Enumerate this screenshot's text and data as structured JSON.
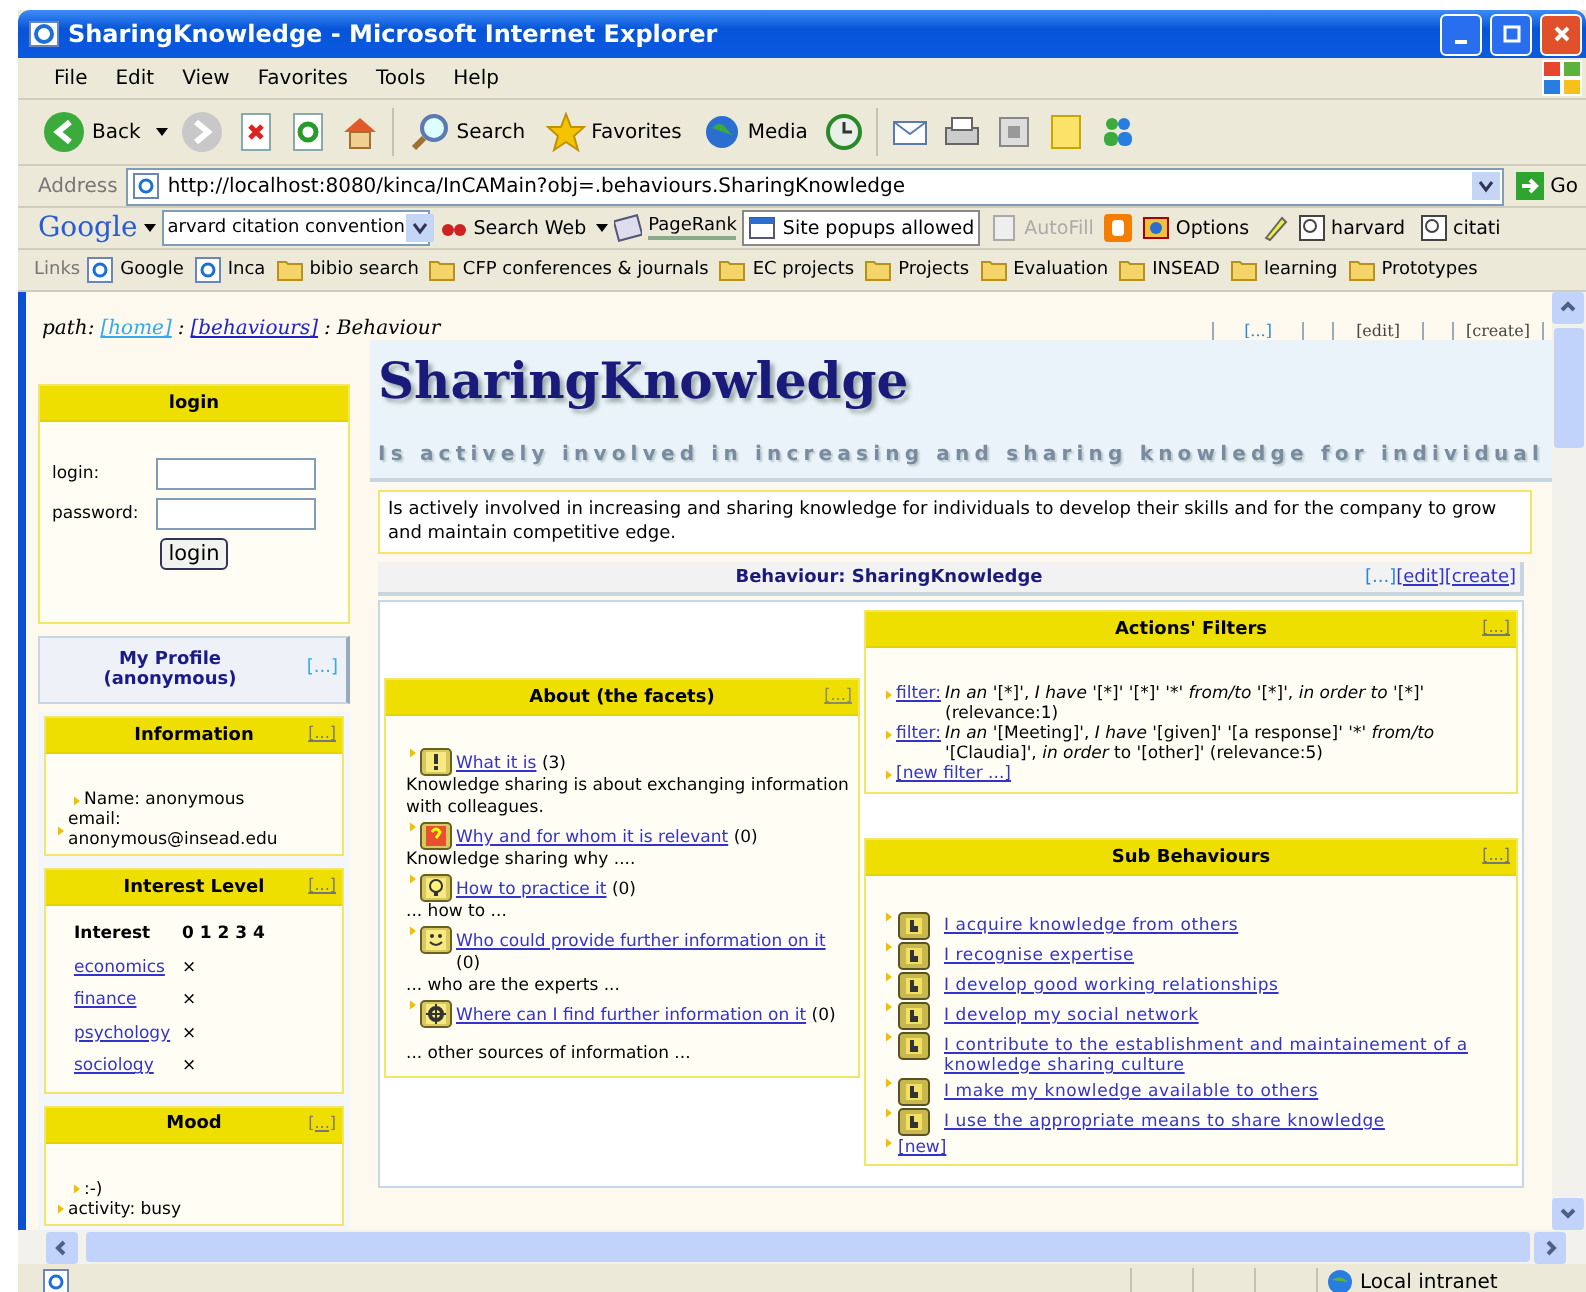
{
  "window": {
    "title": "SharingKnowledge - Microsoft Internet Explorer"
  },
  "menu": [
    "File",
    "Edit",
    "View",
    "Favorites",
    "Tools",
    "Help"
  ],
  "toolbar": {
    "back": "Back",
    "search": "Search",
    "favorites": "Favorites",
    "media": "Media"
  },
  "address": {
    "label": "Address",
    "url": "http://localhost:8080/kinca/InCAMain?obj=.behaviours.SharingKnowledge",
    "go": "Go"
  },
  "google_bar": {
    "logo": "Google",
    "query": "arvard citation convention",
    "search_web": "Search Web",
    "pagerank": "PageRank",
    "popups": "Site popups allowed",
    "autofill": {
      "label": "AutoFill",
      "disabled": true
    },
    "options": "Options",
    "bookmarks": [
      "harvard",
      "citati"
    ]
  },
  "links_bar": {
    "label": "Links",
    "items": [
      {
        "label": "Google",
        "kind": "page"
      },
      {
        "label": "Inca",
        "kind": "page"
      },
      {
        "label": "bibio search",
        "kind": "folder"
      },
      {
        "label": "CFP conferences & journals",
        "kind": "folder"
      },
      {
        "label": "EC projects",
        "kind": "folder"
      },
      {
        "label": "Projects",
        "kind": "folder"
      },
      {
        "label": "Evaluation",
        "kind": "folder"
      },
      {
        "label": "INSEAD",
        "kind": "folder"
      },
      {
        "label": "learning",
        "kind": "folder"
      },
      {
        "label": "Prototypes",
        "kind": "folder"
      }
    ]
  },
  "path": {
    "label": "path:",
    "separator": ":",
    "items": [
      {
        "label": "[home]",
        "visited": true
      },
      {
        "label": "[behaviours]",
        "visited": false
      }
    ],
    "current": "Behaviour"
  },
  "page_actions": [
    {
      "label": "[...]",
      "kind": "more"
    },
    {
      "label": "[edit]",
      "kind": "plain"
    },
    {
      "label": "[create]",
      "kind": "plain"
    }
  ],
  "header": {
    "title": "SharingKnowledge",
    "subtitle": "Is actively involved in increasing and sharing knowledge for individual"
  },
  "description": "Is actively involved in increasing and sharing knowledge for individuals to develop their skills and for the company to grow and maintain competitive edge.",
  "behaviour_bar": {
    "title": "Behaviour: SharingKnowledge",
    "actions": [
      {
        "label": "[...]",
        "kind": "more"
      },
      {
        "label": "[edit]",
        "kind": "link"
      },
      {
        "label": "[create]",
        "kind": "link"
      }
    ]
  },
  "login": {
    "title": "login",
    "login_label": "login:",
    "password_label": "password:",
    "button": "login"
  },
  "profile": {
    "title": "My Profile (anonymous)",
    "more": "[...]"
  },
  "information": {
    "title": "Information",
    "more": "[...]",
    "items": [
      "Name: anonymous",
      "email: anonymous@insead.edu"
    ]
  },
  "interest": {
    "title": "Interest Level",
    "more": "[...]",
    "heading": "Interest",
    "scale": "0 1 2 3 4",
    "topics": [
      {
        "name": "economics",
        "mark": "×"
      },
      {
        "name": "finance",
        "mark": "×"
      },
      {
        "name": "psychology",
        "mark": "×"
      },
      {
        "name": "sociology",
        "mark": "×"
      }
    ]
  },
  "mood": {
    "title": "Mood",
    "more": "[...]",
    "items": [
      ":-)",
      "activity: busy"
    ]
  },
  "facets": {
    "title": "About (the facets)",
    "more": "[...]",
    "items": [
      {
        "kind": "exclaim",
        "label": "What it is",
        "count": "(3)",
        "text": "Knowledge sharing is about exchanging information with colleagues."
      },
      {
        "kind": "question",
        "label": "Why and for whom it is relevant",
        "count": "(0)",
        "text": "Knowledge sharing why ...."
      },
      {
        "kind": "bulb",
        "label": "How to practice it",
        "count": "(0)",
        "text": "... how to ..."
      },
      {
        "kind": "smiley",
        "label": "Who could provide further information on it",
        "count": "(0)",
        "text": "... who are the experts ..."
      },
      {
        "kind": "gear",
        "label": "Where can I find further information on it",
        "count": "(0)",
        "text": "... other sources of information ..."
      }
    ]
  },
  "filters": {
    "title": "Actions' Filters",
    "more": "[...]",
    "items": [
      {
        "link": "filter:",
        "parts": [
          {
            "text": "In an",
            "italic": true
          },
          {
            "text": " '[*]', ",
            "italic": false
          },
          {
            "text": "I have",
            "italic": true
          },
          {
            "text": " '[*]' '[*]' '*' ",
            "italic": false
          },
          {
            "text": "from/to",
            "italic": true
          },
          {
            "text": " '[*]', ",
            "italic": false
          },
          {
            "text": "in order to",
            "italic": true
          },
          {
            "text": " '[*]' (relevance:1)",
            "italic": false
          }
        ]
      },
      {
        "link": "filter:",
        "parts": [
          {
            "text": "In an",
            "italic": true
          },
          {
            "text": " '[Meeting]', ",
            "italic": false
          },
          {
            "text": "I have",
            "italic": true
          },
          {
            "text": " '[given]' '[a response]' '*' ",
            "italic": false
          },
          {
            "text": "from/to",
            "italic": true
          },
          {
            "text": " '[Claudia]', ",
            "italic": false
          },
          {
            "text": "in order",
            "italic": true
          },
          {
            "text": " to '[other]' (relevance:5)",
            "italic": false
          }
        ]
      }
    ],
    "new_link": "[new filter ...]"
  },
  "sub_behaviours": {
    "title": "Sub Behaviours",
    "more": "[...]",
    "items": [
      "I acquire knowledge from others",
      "I recognise expertise",
      "I develop good working relationships",
      "I develop my social network",
      "I contribute to the establishment and maintainement of a knowledge sharing culture",
      "I make my knowledge available to others",
      "I use the appropriate means to share knowledge"
    ],
    "new_link": "[new]"
  },
  "status_bar": {
    "zone": "Local intranet"
  }
}
